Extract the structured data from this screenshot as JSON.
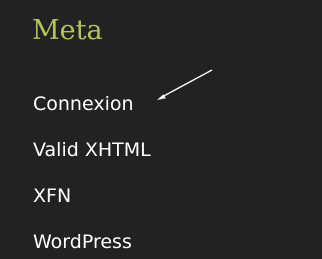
{
  "widget": {
    "title": "Meta",
    "title_color": "#b3c45c",
    "background": "#222222",
    "links": [
      {
        "label": "Connexion"
      },
      {
        "label": "Valid XHTML"
      },
      {
        "label": "XFN"
      },
      {
        "label": "WordPress"
      }
    ],
    "annotation": {
      "icon": "arrow-pointer-icon",
      "color": "#ffffff",
      "target": "Connexion"
    }
  }
}
